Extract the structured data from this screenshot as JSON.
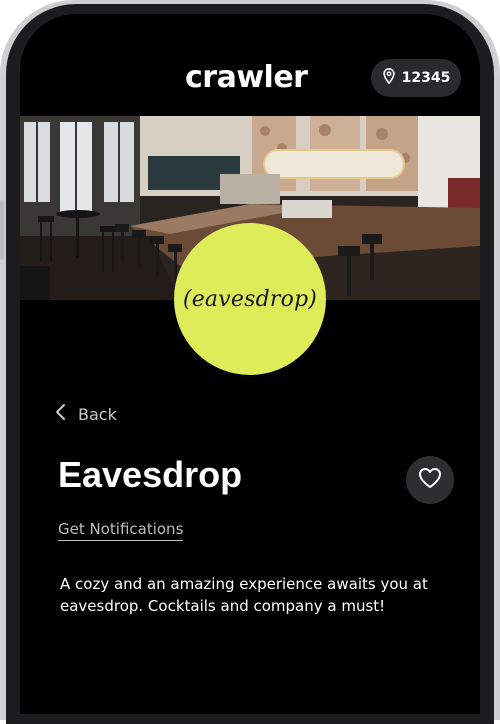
{
  "app": {
    "brand": "crawler"
  },
  "location": {
    "zip": "12345",
    "icon": "map-pin-icon"
  },
  "hero": {
    "logo_text": "(eavesdrop)",
    "logo_color": "#dfec5a"
  },
  "nav": {
    "back_label": "Back"
  },
  "venue": {
    "name": "Eavesdrop",
    "notifications_label": "Get Notifications",
    "description": "A cozy and an amazing experience awaits you at eavesdrop. Cocktails and company a must!"
  },
  "colors": {
    "background": "#000000",
    "accent": "#dfec5a",
    "pill": "#2a2a2c"
  }
}
